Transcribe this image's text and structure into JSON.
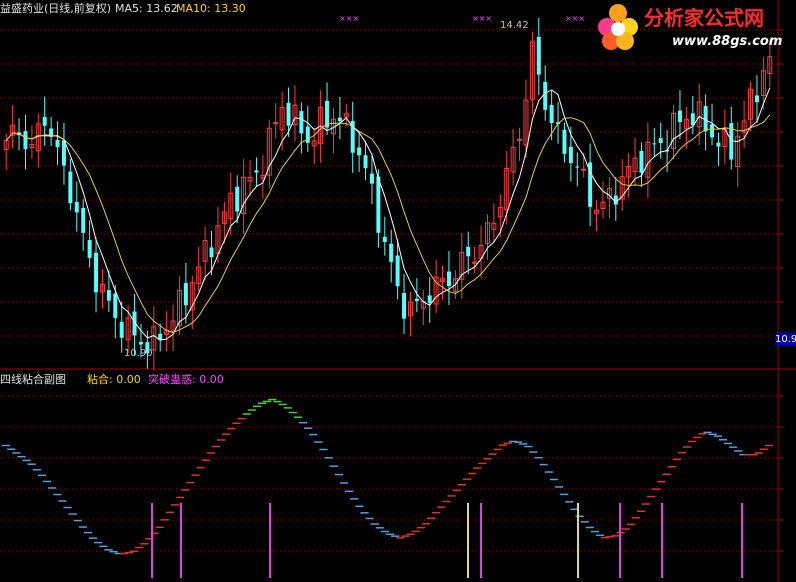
{
  "main_header": {
    "title": "益盛药业(日线,前复权)",
    "ma5_label": "MA5: 13.62",
    "ma10_label": "MA10: 13.30"
  },
  "annotations": {
    "high_price": "14.42",
    "low_price": "10.90",
    "axis_price": "10.9",
    "marker": "×××"
  },
  "sub_header": {
    "title": "四线粘合副图",
    "nianhe_label": "粘合: 0.00",
    "breakout_label": "突破蛊惑: 0.00"
  },
  "watermark": {
    "brand": "分析家公式网",
    "url": "www.88gs.com"
  },
  "colors": {
    "up": "#ff3b3b",
    "down": "#54ffff",
    "ma5": "#ffffff",
    "ma10": "#e6c84b",
    "grid": "#8b0000",
    "line_blue": "#4f9fe0",
    "line_red": "#e03030",
    "line_green": "#40d040",
    "bar_magenta": "#e040e0",
    "bar_yellow": "#e0e060",
    "header_white": "#e0e0e0",
    "header_yellow": "#ffd700",
    "header_magenta": "#ff40ff",
    "marker": "#ff40ff"
  },
  "chart_data": [
    {
      "type": "candlestick",
      "title": "益盛药业(日线,前复权)",
      "series": [
        {
          "name": "MA5",
          "latest": 13.62
        },
        {
          "name": "MA10",
          "latest": 13.3
        }
      ],
      "annotations": [
        {
          "label": "14.42",
          "kind": "high"
        },
        {
          "label": "10.90",
          "kind": "low"
        }
      ],
      "ylim": [
        10.7,
        14.6
      ],
      "price_path": [
        13.2,
        13.3,
        13.1,
        13.5,
        13.0,
        12.6,
        12.0,
        11.6,
        11.3,
        11.1,
        11.0,
        10.9,
        11.1,
        11.3,
        11.6,
        11.9,
        12.2,
        12.5,
        12.7,
        12.8,
        13.2,
        13.6,
        13.4,
        13.2,
        13.4,
        13.5,
        13.3,
        13.0,
        12.5,
        11.9,
        11.4,
        11.3,
        11.5,
        11.6,
        11.7,
        11.9,
        12.0,
        12.3,
        12.8,
        13.3,
        14.2,
        13.6,
        13.2,
        13.0,
        12.7,
        12.4,
        12.6,
        12.8,
        13.0,
        13.1,
        13.2,
        13.4,
        13.5,
        13.4,
        13.2,
        13.1,
        13.4,
        13.8,
        14.1
      ]
    },
    {
      "type": "line",
      "title": "四线粘合副图",
      "series": [
        {
          "name": "粘合",
          "latest": 0.0
        },
        {
          "name": "突破蛊惑",
          "latest": 0.0
        }
      ],
      "ylim": [
        0,
        8
      ],
      "values": [
        5.6,
        5.2,
        4.8,
        4.2,
        3.5,
        2.8,
        2.1,
        1.5,
        1.1,
        0.9,
        1.0,
        1.4,
        2.0,
        2.8,
        3.6,
        4.4,
        5.2,
        5.9,
        6.5,
        7.0,
        7.4,
        7.6,
        7.3,
        6.8,
        6.2,
        5.4,
        4.5,
        3.6,
        2.8,
        2.2,
        1.8,
        1.6,
        1.8,
        2.2,
        2.8,
        3.4,
        4.0,
        4.6,
        5.1,
        5.6,
        5.8,
        5.6,
        5.0,
        4.2,
        3.4,
        2.6,
        2.0,
        1.6,
        1.7,
        2.1,
        2.8,
        3.6,
        4.4,
        5.2,
        5.8,
        6.2,
        6.0,
        5.6,
        5.2,
        5.2,
        5.6
      ]
    }
  ]
}
